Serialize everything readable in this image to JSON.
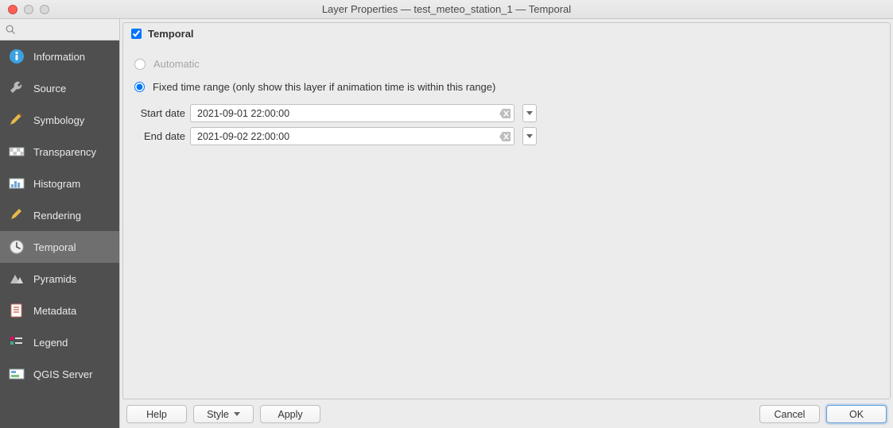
{
  "window_title": "Layer Properties — test_meteo_station_1 — Temporal",
  "search": {
    "placeholder": ""
  },
  "sidebar": {
    "items": [
      {
        "label": "Information",
        "icon": "info"
      },
      {
        "label": "Source",
        "icon": "wrench"
      },
      {
        "label": "Symbology",
        "icon": "brush"
      },
      {
        "label": "Transparency",
        "icon": "transparency"
      },
      {
        "label": "Histogram",
        "icon": "histogram"
      },
      {
        "label": "Rendering",
        "icon": "render"
      },
      {
        "label": "Temporal",
        "icon": "clock",
        "active": true
      },
      {
        "label": "Pyramids",
        "icon": "pyramids"
      },
      {
        "label": "Metadata",
        "icon": "metadata"
      },
      {
        "label": "Legend",
        "icon": "legend"
      },
      {
        "label": "QGIS Server",
        "icon": "server"
      }
    ]
  },
  "panel": {
    "checked": true,
    "title": "Temporal",
    "automatic_label": "Automatic",
    "fixed_label": "Fixed time range (only show this layer if animation time is within this range)",
    "start_label": "Start date",
    "end_label": "End date",
    "start_value": "2021-09-01 22:00:00",
    "end_value": "2021-09-02 22:00:00"
  },
  "buttons": {
    "help": "Help",
    "style": "Style",
    "apply": "Apply",
    "cancel": "Cancel",
    "ok": "OK"
  }
}
